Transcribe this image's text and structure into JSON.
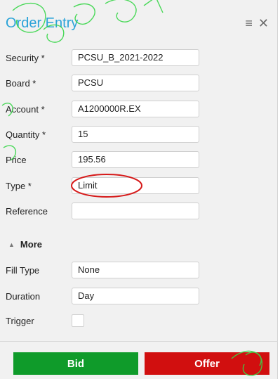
{
  "header": {
    "title": "Order Entry",
    "menu_icon": "hamburger-menu-icon",
    "close_icon": "close-icon"
  },
  "fields": {
    "security": {
      "label": "Security *",
      "value": "PCSU_B_2021-2022"
    },
    "board": {
      "label": "Board *",
      "value": "PCSU"
    },
    "account": {
      "label": "Account *",
      "value": "A1200000R.EX"
    },
    "quantity": {
      "label": "Quantity *",
      "value": "15"
    },
    "price": {
      "label": "Price",
      "value": "195.56"
    },
    "type": {
      "label": "Type *",
      "value": "Limit"
    },
    "reference": {
      "label": "Reference",
      "value": ""
    }
  },
  "more": {
    "label": "More",
    "icon": "caret-up-icon"
  },
  "advanced": {
    "fill_type": {
      "label": "Fill Type",
      "value": "None"
    },
    "duration": {
      "label": "Duration",
      "value": "Day"
    },
    "trigger": {
      "label": "Trigger"
    }
  },
  "actions": {
    "bid_label": "Bid",
    "offer_label": "Offer"
  },
  "colors": {
    "title": "#2aa3d8",
    "bid": "#0f9b2a",
    "offer": "#d10f0f",
    "annotation": "#d61a1a",
    "watermark": "#37d648"
  }
}
